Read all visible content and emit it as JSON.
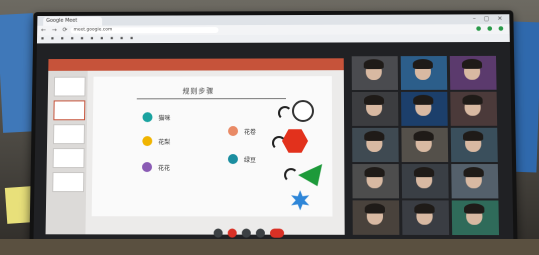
{
  "browser": {
    "tab_title": "Google Meet",
    "url_text": "meet.google.com",
    "bookmarks": [
      "",
      "",
      "",
      "",
      "",
      "",
      "",
      "",
      "",
      ""
    ]
  },
  "slide": {
    "title": "规则步骤",
    "items": [
      {
        "label": "猫咪",
        "color": "#1aa3a0"
      },
      {
        "label": "花梨",
        "color": "#f0b400"
      },
      {
        "label": "花花",
        "color": "#8a5bb4"
      },
      {
        "label": "花卷",
        "color": "#e98a66"
      },
      {
        "label": "绿豆",
        "color": "#1b8ea0"
      }
    ]
  },
  "participants": [
    {
      "name": ""
    },
    {
      "name": ""
    },
    {
      "name": ""
    },
    {
      "name": ""
    },
    {
      "name": ""
    },
    {
      "name": ""
    },
    {
      "name": ""
    },
    {
      "name": ""
    },
    {
      "name": ""
    },
    {
      "name": ""
    },
    {
      "name": ""
    },
    {
      "name": ""
    },
    {
      "name": ""
    },
    {
      "name": ""
    },
    {
      "name": ""
    }
  ],
  "colors": {
    "accent_red": "#d93025",
    "ppt_header": "#c6533a",
    "shape_hexagon": "#e2311c",
    "shape_triangle": "#1d9a3a",
    "shape_star": "#2e86d8"
  }
}
